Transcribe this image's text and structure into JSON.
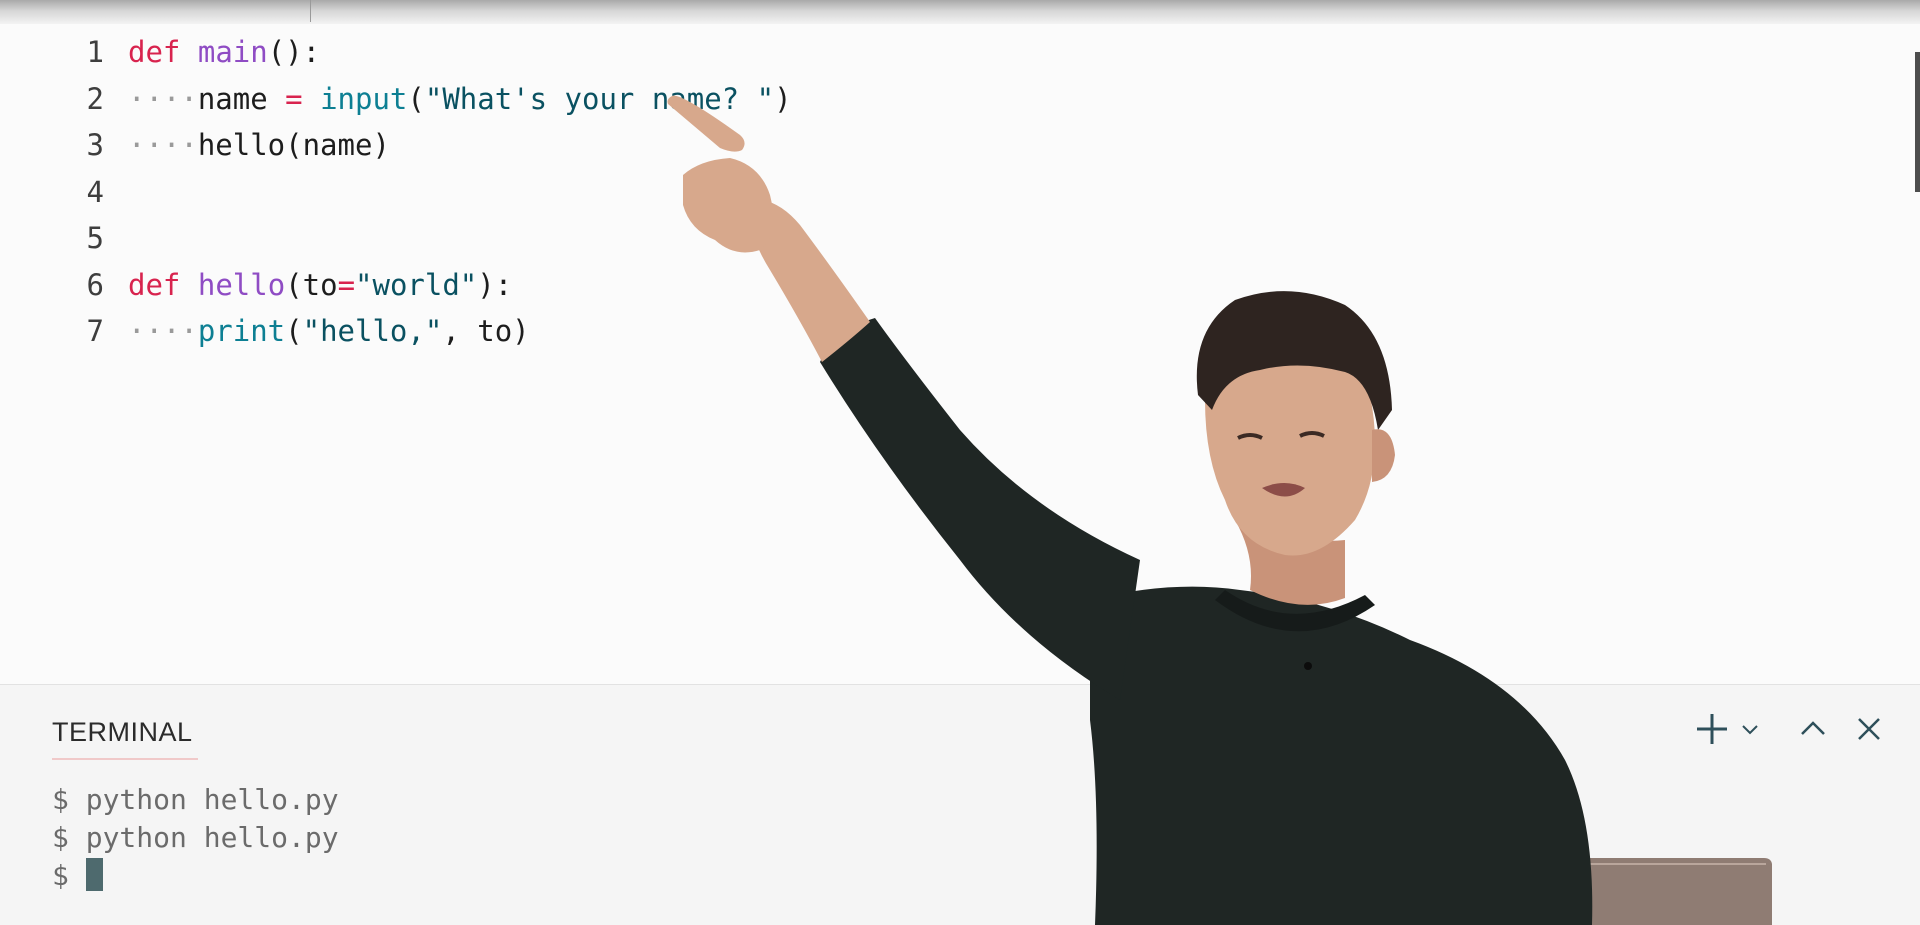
{
  "editor": {
    "lines": [
      {
        "num": "1",
        "tokens": [
          {
            "t": "def",
            "c": "kw"
          },
          {
            "t": " ",
            "c": "pl"
          },
          {
            "t": "main",
            "c": "fn"
          },
          {
            "t": "():",
            "c": "pl"
          }
        ]
      },
      {
        "num": "2",
        "tokens": [
          {
            "t": "····",
            "c": "ws"
          },
          {
            "t": "name ",
            "c": "pl"
          },
          {
            "t": "=",
            "c": "op"
          },
          {
            "t": " ",
            "c": "pl"
          },
          {
            "t": "input",
            "c": "bi"
          },
          {
            "t": "(",
            "c": "pl"
          },
          {
            "t": "\"What's your name? \"",
            "c": "str"
          },
          {
            "t": ")",
            "c": "pl"
          }
        ]
      },
      {
        "num": "3",
        "tokens": [
          {
            "t": "····",
            "c": "ws"
          },
          {
            "t": "hello(name)",
            "c": "pl"
          }
        ]
      },
      {
        "num": "4",
        "tokens": []
      },
      {
        "num": "5",
        "tokens": []
      },
      {
        "num": "6",
        "tokens": [
          {
            "t": "def",
            "c": "kw"
          },
          {
            "t": " ",
            "c": "pl"
          },
          {
            "t": "hello",
            "c": "fn"
          },
          {
            "t": "(to",
            "c": "pl"
          },
          {
            "t": "=",
            "c": "op"
          },
          {
            "t": "\"world\"",
            "c": "str"
          },
          {
            "t": "):",
            "c": "pl"
          }
        ]
      },
      {
        "num": "7",
        "tokens": [
          {
            "t": "····",
            "c": "ws"
          },
          {
            "t": "print",
            "c": "bi"
          },
          {
            "t": "(",
            "c": "pl"
          },
          {
            "t": "\"hello,\"",
            "c": "str"
          },
          {
            "t": ", to)",
            "c": "pl"
          }
        ]
      }
    ]
  },
  "terminal": {
    "title": "TERMINAL",
    "lines": [
      "$ python hello.py",
      "$ python hello.py",
      "$ "
    ],
    "buttons": {
      "new": "plus-icon",
      "dropdown": "chevron-down-icon",
      "maximize": "chevron-up-icon",
      "close": "close-icon"
    }
  },
  "colors": {
    "keyword": "#d8234e",
    "function": "#8f4cc4",
    "builtin": "#0d7f93",
    "string": "#0a5161",
    "shirt": "#1f2624",
    "skin": "#d7a88c"
  }
}
